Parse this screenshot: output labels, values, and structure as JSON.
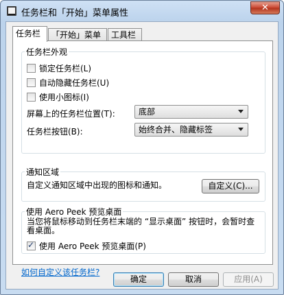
{
  "window": {
    "title": "任务栏和「开始」菜单属性",
    "close_label": "✕"
  },
  "tabs": [
    {
      "label": "任务栏",
      "active": true
    },
    {
      "label": "「开始」菜单",
      "active": false
    },
    {
      "label": "工具栏",
      "active": false
    }
  ],
  "appearance": {
    "legend": "任务栏外观",
    "checkboxes": [
      {
        "label": "锁定任务栏(L)",
        "checked": false
      },
      {
        "label": "自动隐藏任务栏(U)",
        "checked": false
      },
      {
        "label": "使用小图标(I)",
        "checked": false
      }
    ],
    "position_label": "屏幕上的任务栏位置(T):",
    "position_value": "底部",
    "buttons_label": "任务栏按钮(B):",
    "buttons_value": "始终合并、隐藏标签"
  },
  "notification": {
    "legend": "通知区域",
    "text": "自定义通知区域中出现的图标和通知。",
    "customize_label": "自定义(C)..."
  },
  "aeropeek": {
    "legend": "使用 Aero Peek 预览桌面",
    "description": "当您将鼠标移动到任务栏末端的 “显示桌面” 按钮时，会暂时查看桌面。",
    "checkbox_label": "使用 Aero Peek 预览桌面(P)",
    "checked": true
  },
  "help_link": "如何自定义该任务栏?",
  "footer": {
    "ok": "确定",
    "cancel": "取消",
    "apply": "应用(A)"
  }
}
